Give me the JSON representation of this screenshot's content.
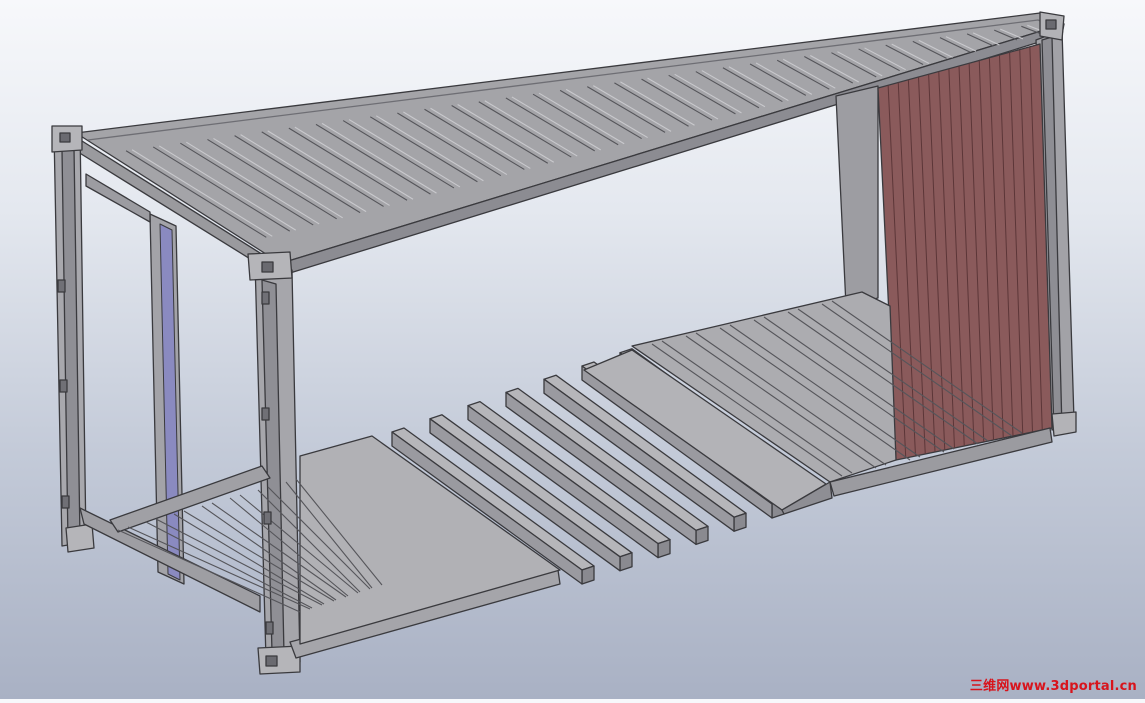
{
  "viewport": {
    "model": "shipping-container-frame",
    "background_top": "#f7f8fb",
    "background_bottom": "#a9b1c4",
    "frame_color": "#a9a9ad",
    "roof_color": "#a4a4a8",
    "door_color": "#8a5a5b",
    "edge_color": "#3a3a3e"
  },
  "watermark": {
    "text": "三维网www.3dportal.cn",
    "color": "#d8141c"
  }
}
